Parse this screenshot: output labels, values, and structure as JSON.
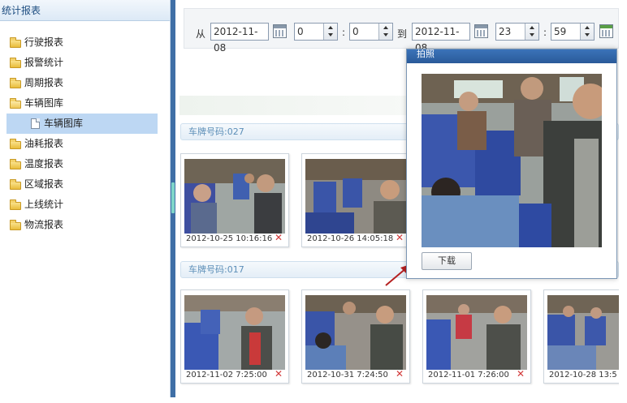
{
  "sidebar": {
    "title": "统计报表",
    "items": [
      {
        "label": "行驶报表"
      },
      {
        "label": "报警统计"
      },
      {
        "label": "周期报表"
      },
      {
        "label": "车辆图库"
      },
      {
        "label": "车辆图库"
      },
      {
        "label": "油耗报表"
      },
      {
        "label": "温度报表"
      },
      {
        "label": "区域报表"
      },
      {
        "label": "上线统计"
      },
      {
        "label": "物流报表"
      }
    ]
  },
  "filter": {
    "from_label": "从",
    "to_label": "到",
    "start_date": "2012-11-08",
    "start_hour": "0",
    "start_minute": "0",
    "end_date": "2012-11-08",
    "end_hour": "23",
    "end_minute": "59",
    "time_sep": ":"
  },
  "groups": [
    {
      "plate": "车牌号码:027",
      "photos": [
        {
          "time": "2012-10-25 10:16:16",
          "delete": "✕"
        },
        {
          "time": "2012-10-26 14:05:18",
          "delete": "✕"
        }
      ]
    },
    {
      "plate": "车牌号码:017",
      "photos": [
        {
          "time": "2012-11-02 7:25:00",
          "delete": "✕"
        },
        {
          "time": "2012-10-31 7:24:50",
          "delete": "✕"
        },
        {
          "time": "2012-11-01 7:26:00",
          "delete": "✕"
        },
        {
          "time": "2012-10-28 13:5",
          "delete": "✕"
        }
      ]
    }
  ],
  "popup": {
    "title": "拍照",
    "download_label": "下载"
  },
  "colors": {
    "accent": "#2a5a99",
    "selected": "#bdd7f3",
    "delete": "#d23a3a",
    "plate_text": "#5d8fb8",
    "splitter": "#3f6fa6"
  }
}
